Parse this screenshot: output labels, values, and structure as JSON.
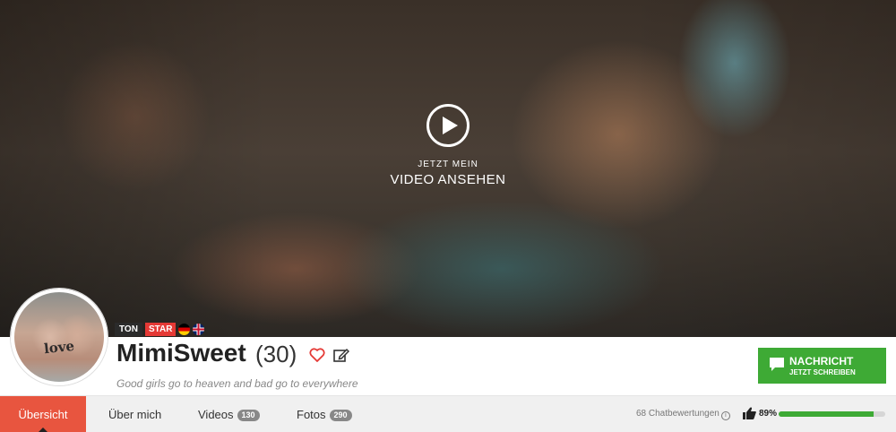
{
  "hero": {
    "cta_line1": "JETZT MEIN",
    "cta_line2": "VIDEO ANSEHEN"
  },
  "profile": {
    "name": "MimiSweet",
    "age": "(30)",
    "motto": "Good girls go to heaven and bad go to everywhere",
    "avatar_tattoo": "love",
    "badges": {
      "ton": "TON",
      "star": "STAR"
    },
    "flags": [
      "flag-de-icon",
      "flag-gb-icon"
    ]
  },
  "message_button": {
    "line1": "NACHRICHT",
    "line2": "JETZT SCHREIBEN",
    "color": "#3eaa35"
  },
  "nav": {
    "tabs": [
      {
        "label": "Übersicht",
        "active": true
      },
      {
        "label": "Über mich"
      },
      {
        "label": "Videos",
        "count": "130"
      },
      {
        "label": "Fotos",
        "count": "290"
      }
    ],
    "active_color": "#e8553f"
  },
  "rating": {
    "reviews": "68 Chatbewertungen",
    "percent_label": "89%",
    "percent": 0.89
  }
}
